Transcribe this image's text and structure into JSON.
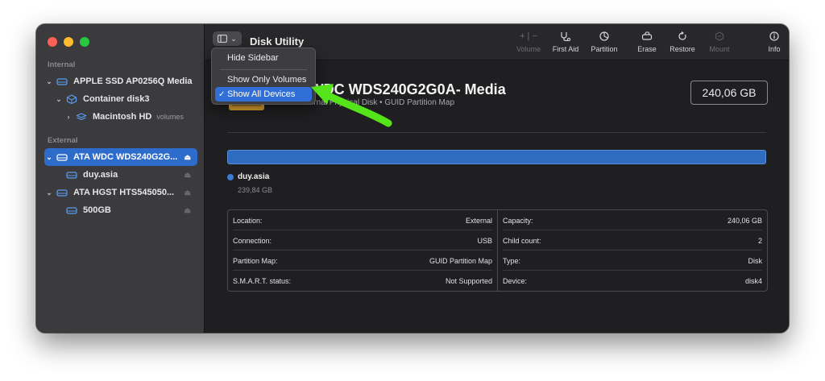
{
  "window": {
    "title": "Disk Utility"
  },
  "sidebar": {
    "sections": {
      "internal": "Internal",
      "external": "External"
    },
    "items": [
      {
        "label": "APPLE SSD AP0256Q Media"
      },
      {
        "label": "Container disk3"
      },
      {
        "label": "Macintosh HD",
        "sub": "volumes"
      },
      {
        "label": "ATA WDC WDS240G2G...",
        "eject": "⏏"
      },
      {
        "label": "duy.asia",
        "eject": "⏏"
      },
      {
        "label": "ATA HGST HTS545050...",
        "eject": "⏏"
      },
      {
        "label": "500GB",
        "eject": "⏏"
      }
    ]
  },
  "toolbar": {
    "view_chevron": "⌄",
    "items": [
      {
        "label": "Volume",
        "glyph": "+ | −"
      },
      {
        "label": "First Aid"
      },
      {
        "label": "Partition"
      },
      {
        "label": "Erase"
      },
      {
        "label": "Restore"
      },
      {
        "label": "Mount"
      },
      {
        "label": "Info"
      }
    ]
  },
  "menu": {
    "items": [
      {
        "label": "Hide Sidebar"
      },
      {
        "label": "Show Only Volumes"
      },
      {
        "label": "Show All Devices",
        "check": "✓"
      }
    ]
  },
  "disk": {
    "title": "ATA WDC WDS240G2G0A- Media",
    "subtitle": "SSD External Physical Disk • GUID Partition Map",
    "capacity": "240,06 GB"
  },
  "usage": {
    "name": "duy.asia",
    "size": "239,84 GB"
  },
  "info": {
    "left": [
      {
        "key": "Location:",
        "value": "External"
      },
      {
        "key": "Connection:",
        "value": "USB"
      },
      {
        "key": "Partition Map:",
        "value": "GUID Partition Map"
      },
      {
        "key": "S.M.A.R.T. status:",
        "value": "Not Supported"
      }
    ],
    "right": [
      {
        "key": "Capacity:",
        "value": "240,06 GB"
      },
      {
        "key": "Child count:",
        "value": "2"
      },
      {
        "key": "Type:",
        "value": "Disk"
      },
      {
        "key": "Device:",
        "value": "disk4"
      }
    ]
  },
  "colors": {
    "accent": "#2d6ccb",
    "annotation_arrow": "#55e41a"
  }
}
